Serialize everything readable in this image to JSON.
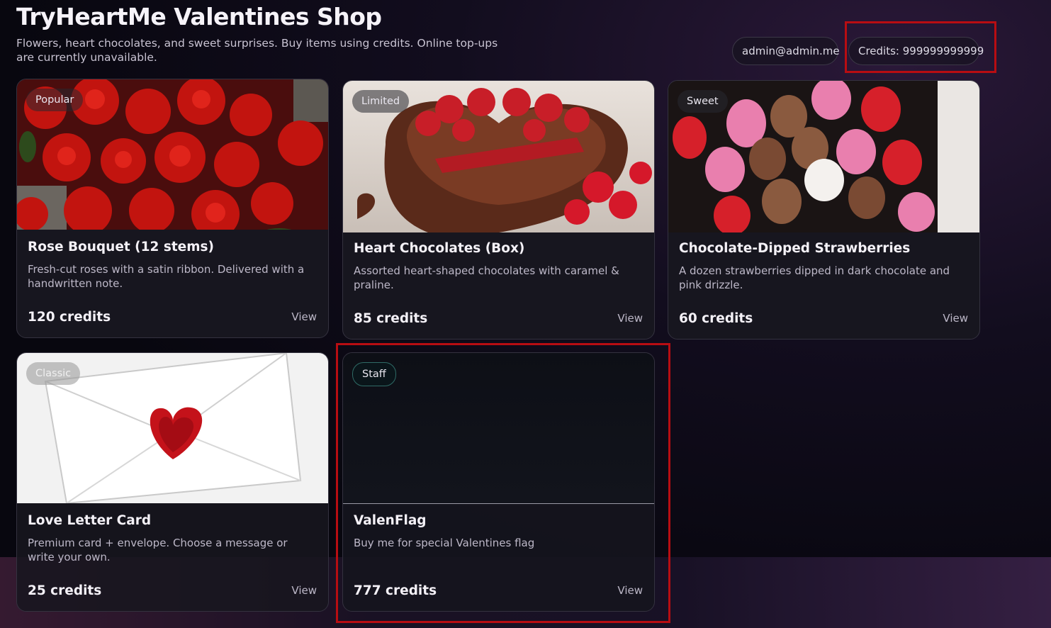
{
  "header": {
    "title": "TryHeartMe Valentines Shop",
    "subtitle": "Flowers, heart chocolates, and sweet surprises. Buy items using credits. Online top-ups are currently unavailable."
  },
  "account": {
    "email": "admin@admin.me",
    "credits_label": "Credits: 999999999999"
  },
  "products": [
    {
      "name": "Rose Bouquet (12 stems)",
      "tag": "Popular",
      "description": "Fresh-cut roses with a satin ribbon. Delivered with a handwritten note.",
      "price": "120 credits",
      "action": "View",
      "image": "rose-bouquet-image"
    },
    {
      "name": "Heart Chocolates (Box)",
      "tag": "Limited",
      "description": "Assorted heart-shaped chocolates with caramel & praline.",
      "price": "85 credits",
      "action": "View",
      "image": "heart-chocolate-box-image"
    },
    {
      "name": "Chocolate-Dipped Strawberries",
      "tag": "Sweet",
      "description": "A dozen strawberries dipped in dark chocolate and pink drizzle.",
      "price": "60 credits",
      "action": "View",
      "image": "dipped-strawberries-image"
    },
    {
      "name": "Love Letter Card",
      "tag": "Classic",
      "description": "Premium card + envelope. Choose a message or write your own.",
      "price": "25 credits",
      "action": "View",
      "image": "sealed-envelope-image"
    },
    {
      "name": "ValenFlag",
      "tag": "Staff",
      "description": "Buy me for special Valentines flag",
      "price": "777 credits",
      "action": "View",
      "image": "blank-dark-image"
    }
  ],
  "colors": {
    "highlight": "#b80d12",
    "card_bg": "#17161f",
    "page_bg": "#08070f"
  }
}
